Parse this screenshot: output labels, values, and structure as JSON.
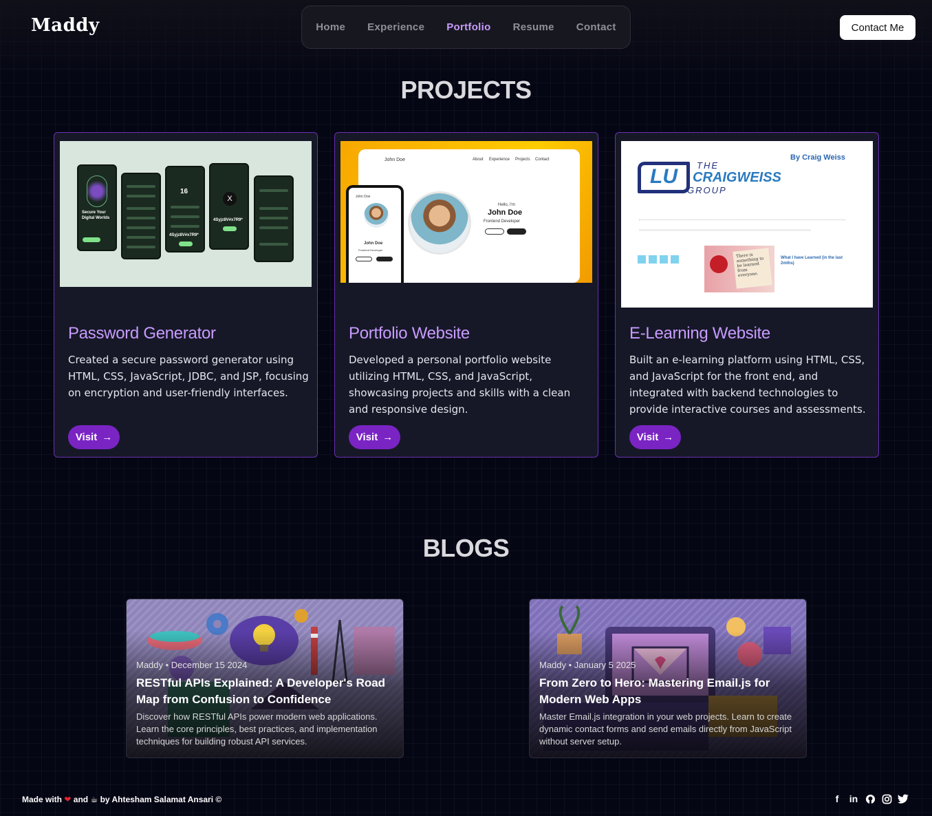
{
  "header": {
    "logo": "Maddy",
    "nav": [
      "Home",
      "Experience",
      "Portfolio",
      "Resume",
      "Contact"
    ],
    "active_nav": "Portfolio",
    "contact_button": "Contact Me"
  },
  "projects": {
    "title": "PROJECTS",
    "items": [
      {
        "title": "Password Generator",
        "description": "Created a secure password generator using HTML, CSS, JavaScript, JDBC, and JSP, focusing on encryption and user-friendly interfaces.",
        "button": "Visit",
        "preview": {
          "heading": "Secure Your Digital Worlds",
          "counter": "16",
          "password": "4Syjz8V#x7R9*"
        }
      },
      {
        "title": "Portfolio Website",
        "description": "Developed a personal portfolio website utilizing HTML, CSS, and JavaScript, showcasing projects and skills with a clean and responsive design.",
        "button": "Visit",
        "preview": {
          "brand": "John Doe",
          "menu": [
            "About",
            "Experience",
            "Projects",
            "Contact"
          ],
          "greeting": "Hello, I'm",
          "name": "John Doe",
          "role": "Frontend Developer",
          "cv": "Download CV",
          "contact": "Contact Info"
        }
      },
      {
        "title": "E-Learning Website",
        "description": "Built an e-learning platform using HTML, CSS, and JavaScript for the front end, and integrated with backend technologies to provide interactive courses and assessments.",
        "button": "Visit",
        "preview": {
          "byline": "By Craig Weiss",
          "logo_line1": "THE",
          "logo_line2": "CRAIGWEISS",
          "logo_line3": "GROUP",
          "post_title": "What I have Learned (in the last 2mths)",
          "note": "There is something to be learned from everyone."
        }
      }
    ]
  },
  "blogs": {
    "title": "BLOGS",
    "items": [
      {
        "meta": "Maddy • December 15 2024",
        "title": "RESTful APIs Explained: A Developer's Road Map from Confusion to Confidence",
        "description": "Discover how RESTful APIs power modern web applications. Learn the core principles, best practices, and implementation techniques for building robust API services."
      },
      {
        "meta": "Maddy • January 5 2025",
        "title": "From Zero to Hero: Mastering Email.js for Modern Web Apps",
        "description": "Master Email.js integration in your web projects. Learn to create dynamic contact forms and send emails directly from JavaScript without server setup."
      }
    ]
  },
  "footer": {
    "made_with": "Made with",
    "and": "and",
    "by": "by Ahtesham Salamat Ansari ©",
    "socials": [
      "facebook-icon",
      "linkedin-icon",
      "github-icon",
      "instagram-icon",
      "twitter-icon"
    ]
  },
  "colors": {
    "accent": "#c89bff",
    "button": "#7a24c4",
    "card_border": "#6b2fb4",
    "background": "#050614"
  }
}
